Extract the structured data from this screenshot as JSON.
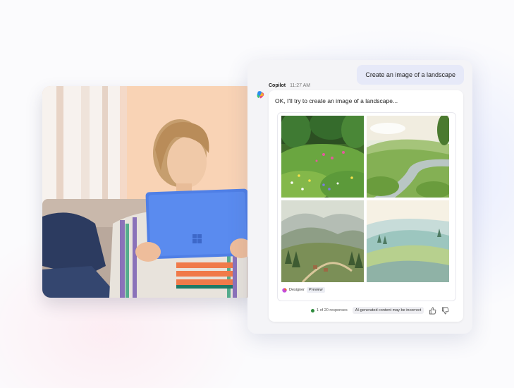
{
  "chat": {
    "user_message": "Create an image of a landscape",
    "assistant_name": "Copilot",
    "timestamp": "11:27 AM",
    "reply_text": "OK, I'll try to create an image of a landscape...",
    "designer_label": "Designer",
    "preview_badge": "Preview",
    "response_count": "1 of 20 responses",
    "disclaimer": "AI-generated content may be incorrect"
  },
  "icons": {
    "assistant_logo": "copilot-logo",
    "designer_logo": "designer-logo",
    "like": "thumbs-up-icon",
    "dislike": "thumbs-down-icon"
  },
  "colors": {
    "user_bubble": "#e6e9f8",
    "status_dot": "#2e8b3d",
    "tablet_blue": "#4f7fe6"
  }
}
